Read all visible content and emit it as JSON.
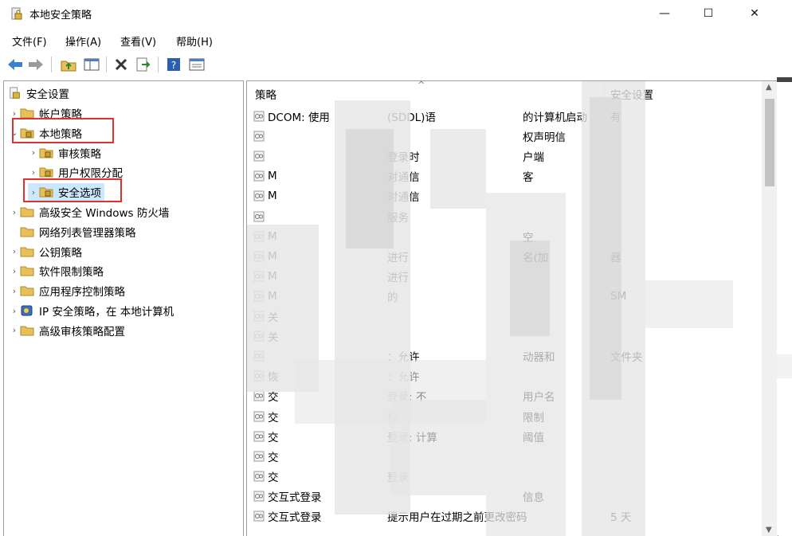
{
  "window": {
    "title": "本地安全策略",
    "minimize": "—",
    "maximize": "☐",
    "close": "✕"
  },
  "menu": [
    "文件(F)",
    "操作(A)",
    "查看(V)",
    "帮助(H)"
  ],
  "toolbar": [
    "back-icon",
    "forward-icon",
    "up-folder-icon",
    "show-hide-tree-icon",
    "delete-icon",
    "export-list-icon",
    "help-icon",
    "properties-icon"
  ],
  "tree": {
    "root": "安全设置",
    "items": [
      {
        "label": "帐户策略",
        "level": 1,
        "arrow": "›",
        "icon": "folder-icon"
      },
      {
        "label": "本地策略",
        "level": 1,
        "arrow": "⌄",
        "icon": "folder-icon",
        "highlight": true
      },
      {
        "label": "审核策略",
        "level": 2,
        "arrow": "›",
        "icon": "folder-icon"
      },
      {
        "label": "用户权限分配",
        "level": 2,
        "arrow": "›",
        "icon": "folder-icon"
      },
      {
        "label": "安全选项",
        "level": 2,
        "arrow": "›",
        "icon": "folder-icon",
        "selected": true,
        "highlight": true
      },
      {
        "label": "高级安全 Windows 防火墙",
        "level": 1,
        "arrow": "›",
        "icon": "folder-icon"
      },
      {
        "label": "网络列表管理器策略",
        "level": 1,
        "arrow": "",
        "icon": "folder-icon"
      },
      {
        "label": "公钥策略",
        "level": 1,
        "arrow": "›",
        "icon": "folder-icon"
      },
      {
        "label": "软件限制策略",
        "level": 1,
        "arrow": "›",
        "icon": "folder-icon"
      },
      {
        "label": "应用程序控制策略",
        "level": 1,
        "arrow": "›",
        "icon": "folder-icon"
      },
      {
        "label": "IP 安全策略，在 本地计算机",
        "level": 1,
        "arrow": "›",
        "icon": "ipsec-icon"
      },
      {
        "label": "高级审核策略配置",
        "level": 1,
        "arrow": "›",
        "icon": "folder-icon"
      }
    ]
  },
  "list": {
    "headers": {
      "policy": "策略",
      "setting": "安全设置"
    },
    "rows": [
      {
        "policy": "DCOM: 使用",
        "mid": "(SDDL)语",
        "tail": "的计算机启动",
        "setting": "有"
      },
      {
        "policy": "",
        "mid": "",
        "tail": "权声明信",
        "setting": ""
      },
      {
        "policy": "",
        "mid": "登录时",
        "tail": "户端",
        "setting": ""
      },
      {
        "policy": "M",
        "mid": "对通信",
        "tail": "客",
        "setting": ""
      },
      {
        "policy": "M",
        "mid": "对通信",
        "tail": "",
        "setting": ""
      },
      {
        "policy": "",
        "mid": "服务",
        "tail": "",
        "setting": ""
      },
      {
        "policy": "M",
        "mid": "",
        "tail": "空",
        "setting": ""
      },
      {
        "policy": "M",
        "mid": "进行",
        "tail": "名(加",
        "setting": "器"
      },
      {
        "policy": "M",
        "mid": "进行",
        "tail": "",
        "setting": ""
      },
      {
        "policy": "M",
        "mid": "的",
        "tail": "",
        "setting": "SM"
      },
      {
        "policy": "关",
        "mid": "",
        "tail": "",
        "setting": ""
      },
      {
        "policy": "关",
        "mid": "",
        "tail": "",
        "setting": ""
      },
      {
        "policy": "",
        "mid": "：允许",
        "tail": "动器和",
        "setting": "文件夹"
      },
      {
        "policy": "恢",
        "mid": "：允许",
        "tail": "",
        "setting": ""
      },
      {
        "policy": "交",
        "mid": "登录: 不",
        "tail": "用户名",
        "setting": ""
      },
      {
        "policy": "交",
        "mid": "登",
        "tail": "限制",
        "setting": ""
      },
      {
        "policy": "交",
        "mid": "登录: 计算",
        "tail": "阈值",
        "setting": ""
      },
      {
        "policy": "交",
        "mid": "",
        "tail": "",
        "setting": ""
      },
      {
        "policy": "交",
        "mid": "登录",
        "tail": "",
        "setting": ""
      },
      {
        "policy": "交互式登录",
        "mid": "",
        "tail": "信息",
        "setting": ""
      },
      {
        "policy": "交互式登录",
        "mid": "提示用户在过期之前更改密码",
        "tail": "",
        "setting": "5 天"
      }
    ]
  },
  "colors": {
    "highlight": "#e0302f",
    "selection": "#cce8ff",
    "folder": "#e8c05a"
  }
}
